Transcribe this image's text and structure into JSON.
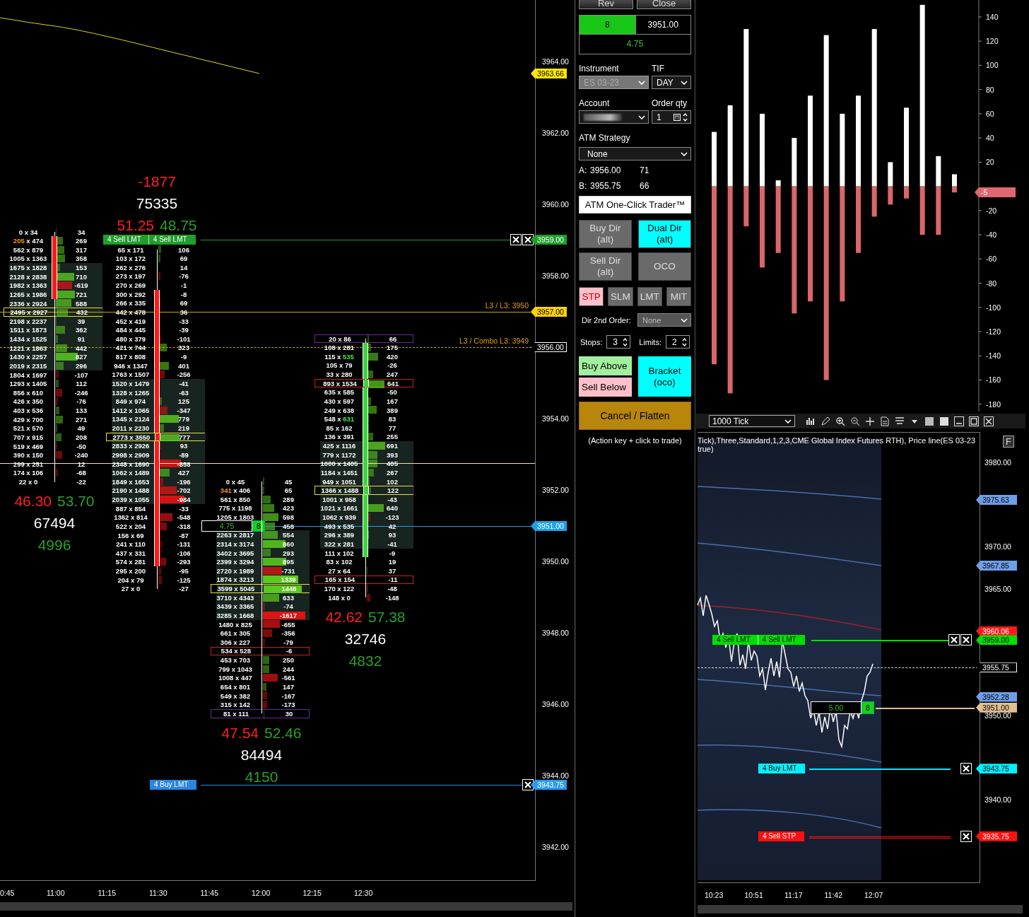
{
  "footprint_chart": {
    "columns": [
      {
        "kind": "bearish",
        "summary_below": {
          "sell_pct": "46.30",
          "buy_pct": "53.70",
          "volume": "67494",
          "delta": "4996"
        },
        "rows": [
          {
            "volume": "0 x 34",
            "delta": "34"
          },
          {
            "volume": "205 x 474",
            "delta": "269",
            "bid_highlighted": true,
            "body": true
          },
          {
            "volume": "562 x 879",
            "delta": "317",
            "body": true
          },
          {
            "volume": "1005 x 1363",
            "delta": "358",
            "body": true
          },
          {
            "volume": "1675 x 1828",
            "delta": "153",
            "value_area": true,
            "body": true
          },
          {
            "volume": "2128 x 2838",
            "delta": "710",
            "value_area": true,
            "body": true
          },
          {
            "volume": "1982 x 1363",
            "delta": "-619",
            "value_area": true,
            "body": true
          },
          {
            "volume": "1265 x 1986",
            "delta": "721",
            "value_area": true,
            "body": true
          },
          {
            "volume": "2336 x 2924",
            "delta": "588",
            "value_area": true
          },
          {
            "volume": "2495 x 2927",
            "delta": "432",
            "value_area": true,
            "color": "#e8e040"
          },
          {
            "volume": "2198 x 2237",
            "delta": "39",
            "value_area": true
          },
          {
            "volume": "1511 x 1873",
            "delta": "362",
            "value_area": true
          },
          {
            "volume": "1434 x 1525",
            "delta": "91",
            "value_area": true
          },
          {
            "volume": "1221 x 1863",
            "delta": "442",
            "value_area": true
          },
          {
            "volume": "1430 x 2257",
            "delta": "827",
            "value_area": true
          },
          {
            "volume": "2019 x 2315",
            "delta": "296",
            "value_area": true
          },
          {
            "volume": "1804 x 1697",
            "delta": "-107"
          },
          {
            "volume": "1293 x 1405",
            "delta": "112"
          },
          {
            "volume": "856 x 610",
            "delta": "-246"
          },
          {
            "volume": "426 x 350",
            "delta": "-76"
          },
          {
            "volume": "403 x 536",
            "delta": "133"
          },
          {
            "volume": "429 x 700",
            "delta": "271"
          },
          {
            "volume": "521 x 570",
            "delta": "49"
          },
          {
            "volume": "707 x 915",
            "delta": "208"
          },
          {
            "volume": "519 x 469",
            "delta": "-50"
          },
          {
            "volume": "390 x 150",
            "delta": "-240"
          },
          {
            "volume": "299 x 251",
            "delta": "12"
          },
          {
            "volume": "174 x 106",
            "delta": "-68"
          },
          {
            "volume": "22 x 0",
            "delta": "-22"
          }
        ]
      },
      {
        "kind": "bearish",
        "summary_above": {
          "sell_pct": "51.25",
          "buy_pct": "48.75",
          "volume": "75335",
          "delta": "-1877"
        },
        "rows": [
          {
            "volume": "65 x 171",
            "delta": "106"
          },
          {
            "volume": "103 x 172",
            "delta": "69"
          },
          {
            "volume": "262 x 276",
            "delta": "14"
          },
          {
            "volume": "273 x 197",
            "delta": "-76"
          },
          {
            "volume": "270 x 269",
            "delta": "-1"
          },
          {
            "volume": "300 x 292",
            "delta": "-8",
            "body": true
          },
          {
            "volume": "266 x 335",
            "delta": "69",
            "body": true
          },
          {
            "volume": "442 x 478",
            "delta": "36",
            "body": true
          },
          {
            "volume": "452 x 419",
            "delta": "-33",
            "body": true
          },
          {
            "volume": "484 x 445",
            "delta": "-39",
            "body": true
          },
          {
            "volume": "480 x 379",
            "delta": "-101",
            "body": true
          },
          {
            "volume": "421 x 744",
            "delta": "323",
            "body": true
          },
          {
            "volume": "817 x 808",
            "delta": "-9",
            "body": true
          },
          {
            "volume": "946 x 1347",
            "delta": "401",
            "body": true
          },
          {
            "volume": "1763 x 1507",
            "delta": "-256",
            "body": true
          },
          {
            "volume": "1520 x 1479",
            "delta": "-41",
            "value_area": true,
            "body": true
          },
          {
            "volume": "1328 x 1265",
            "delta": "-63",
            "value_area": true,
            "body": true
          },
          {
            "volume": "849 x 974",
            "delta": "125",
            "value_area": true,
            "body": true
          },
          {
            "volume": "1412 x 1065",
            "delta": "-347",
            "value_area": true,
            "body": true
          },
          {
            "volume": "1345 x 2124",
            "delta": "779",
            "value_area": true,
            "body": true
          },
          {
            "volume": "2011 x 2230",
            "delta": "219",
            "value_area": true,
            "body": true
          },
          {
            "volume": "2773 x 3550",
            "delta": "777",
            "value_area": true,
            "body": true,
            "color": "#e8e040"
          },
          {
            "volume": "2833 x 2926",
            "delta": "93",
            "value_area": true,
            "body": true
          },
          {
            "volume": "2998 x 2909",
            "delta": "-89",
            "value_area": true,
            "body": true
          },
          {
            "volume": "2348 x 1690",
            "delta": "-858",
            "value_area": true,
            "body": true
          },
          {
            "volume": "1062 x 1489",
            "delta": "427",
            "value_area": true,
            "body": true
          },
          {
            "volume": "1849 x 1653",
            "delta": "-196",
            "value_area": true,
            "body": true
          },
          {
            "volume": "2190 x 1488",
            "delta": "-702",
            "value_area": true,
            "body": true
          },
          {
            "volume": "2039 x 1055",
            "delta": "-984",
            "value_area": true,
            "body": true
          },
          {
            "volume": "887 x 854",
            "delta": "-33",
            "body": true
          },
          {
            "volume": "1362 x 814",
            "delta": "-548",
            "body": true
          },
          {
            "volume": "522 x 204",
            "delta": "-318",
            "body": true
          },
          {
            "volume": "156 x 69",
            "delta": "-87",
            "body": true
          },
          {
            "volume": "241 x 110",
            "delta": "-131",
            "body": true
          },
          {
            "volume": "437 x 331",
            "delta": "-106",
            "body": true
          },
          {
            "volume": "574 x 281",
            "delta": "-293",
            "body": true
          },
          {
            "volume": "295 x 200",
            "delta": "-95"
          },
          {
            "volume": "204 x 79",
            "delta": "-125"
          },
          {
            "volume": "27 x 0",
            "delta": "-27"
          }
        ]
      },
      {
        "kind": "doji",
        "summary_below": {
          "sell_pct": "47.54",
          "buy_pct": "52.46",
          "volume": "84494",
          "delta": "4150"
        },
        "rows": [
          {
            "volume": "0 x 45",
            "delta": "45"
          },
          {
            "volume": "341 x 406",
            "delta": "65",
            "bid_highlighted": true
          },
          {
            "volume": "561 x 850",
            "delta": "289"
          },
          {
            "volume": "775 x 1198",
            "delta": "423"
          },
          {
            "volume": "1205 x 1803",
            "delta": "598"
          },
          {
            "delta": "458"
          },
          {
            "volume": "2263 x 2817",
            "delta": "554",
            "value_area": true
          },
          {
            "volume": "2314 x 3174",
            "delta": "860",
            "value_area": true
          },
          {
            "volume": "3402 x 3695",
            "delta": "293",
            "value_area": true
          },
          {
            "volume": "2399 x 3294",
            "delta": "895",
            "value_area": true
          },
          {
            "volume": "2720 x 1989",
            "delta": "-731",
            "value_area": true
          },
          {
            "volume": "1874 x 3213",
            "delta": "1339",
            "value_area": true
          },
          {
            "volume": "3599 x 5045",
            "delta": "1446",
            "value_area": true,
            "color": "#e8e040"
          },
          {
            "volume": "3710 x 4343",
            "delta": "633",
            "value_area": true
          },
          {
            "volume": "3439 x 3365",
            "delta": "-74",
            "value_area": true
          },
          {
            "volume": "3285 x 1668",
            "delta": "-1617",
            "value_area": true
          },
          {
            "volume": "1480 x 825",
            "delta": "-655"
          },
          {
            "volume": "661 x 305",
            "delta": "-356"
          },
          {
            "volume": "306 x 227",
            "delta": "-79"
          },
          {
            "volume": "534 x 528",
            "delta": "-6",
            "color": "#d02020"
          },
          {
            "volume": "453 x 703",
            "delta": "250"
          },
          {
            "volume": "799 x 1043",
            "delta": "244"
          },
          {
            "volume": "1008 x 447",
            "delta": "-561"
          },
          {
            "volume": "654 x 801",
            "delta": "147"
          },
          {
            "volume": "549 x 382",
            "delta": "-167"
          },
          {
            "volume": "315 x 142",
            "delta": "-173"
          },
          {
            "volume": "81 x 111",
            "delta": "30",
            "color": "#6a2a9a"
          }
        ]
      },
      {
        "kind": "bullish",
        "summary_below": {
          "sell_pct": "42.62",
          "buy_pct": "57.38",
          "volume": "32746",
          "delta": "4832"
        },
        "rows": [
          {
            "volume": "20 x 86",
            "delta": "66",
            "color": "#6a2a9a"
          },
          {
            "volume": "108 x 281",
            "delta": "175",
            "body": true
          },
          {
            "volume": "115 x 535",
            "delta": "420",
            "ask_highlighted": true,
            "body": true
          },
          {
            "volume": "105 x 79",
            "delta": "-26",
            "body": true
          },
          {
            "volume": "33 x 280",
            "delta": "247",
            "body": true
          },
          {
            "volume": "893 x 1534",
            "delta": "641",
            "color": "#d02020",
            "body": true
          },
          {
            "volume": "635 x 585",
            "delta": "-50",
            "body": true
          },
          {
            "volume": "430 x 597",
            "delta": "167",
            "body": true
          },
          {
            "volume": "249 x 638",
            "delta": "389",
            "body": true
          },
          {
            "volume": "548 x 631",
            "delta": "83",
            "ask_highlighted": true,
            "body": true
          },
          {
            "volume": "85 x 162",
            "delta": "77",
            "body": true
          },
          {
            "volume": "136 x 391",
            "delta": "255",
            "body": true
          },
          {
            "volume": "425 x 1116",
            "delta": "691",
            "value_area": true,
            "body": true
          },
          {
            "volume": "779 x 1172",
            "delta": "393",
            "value_area": true,
            "body": true
          },
          {
            "volume": "1000 x 1405",
            "delta": "405",
            "value_area": true,
            "body": true
          },
          {
            "volume": "1184 x 1451",
            "delta": "267",
            "value_area": true,
            "body": true
          },
          {
            "volume": "949 x 1051",
            "delta": "102",
            "value_area": true,
            "body": true
          },
          {
            "volume": "1366 x 1488",
            "delta": "122",
            "value_area": true,
            "color": "#e8e040",
            "body": true
          },
          {
            "volume": "1001 x 958",
            "delta": "-43",
            "value_area": true,
            "body": true
          },
          {
            "volume": "1021 x 1661",
            "delta": "640",
            "value_area": true,
            "body": true
          },
          {
            "volume": "1062 x 939",
            "delta": "-123",
            "value_area": true,
            "body": true
          },
          {
            "volume": "493 x 535",
            "delta": "42",
            "value_area": true,
            "body": true
          },
          {
            "volume": "296 x 389",
            "delta": "93",
            "value_area": true,
            "body": true
          },
          {
            "volume": "322 x 281",
            "delta": "-41",
            "value_area": true,
            "body": true
          },
          {
            "volume": "111 x 102",
            "delta": "-9",
            "body": true
          },
          {
            "volume": "83 x 102",
            "delta": "19"
          },
          {
            "volume": "27 x 64",
            "delta": "37"
          },
          {
            "volume": "165 x 154",
            "delta": "-11",
            "color": "#d02020"
          },
          {
            "volume": "170 x 122",
            "delta": "-48"
          },
          {
            "volume": "148 x 0",
            "delta": "-148"
          }
        ]
      }
    ],
    "price_lines": [
      {
        "kind": "indicator",
        "tag": "3963.66"
      },
      {
        "kind": "sell_limit",
        "tag": "3959.00",
        "labels": [
          "4  Sell LMT",
          "4  Sell LMT"
        ]
      },
      {
        "kind": "level",
        "tag": "3957.00",
        "label": "L3 / L3: 3950"
      },
      {
        "kind": "combo_level",
        "tag": "3956.00",
        "label": "L3 / Combo L3: 3949"
      },
      {
        "kind": "marker"
      },
      {
        "kind": "position",
        "tag": "3951.00",
        "pnl": "4.75",
        "qty": "8"
      },
      {
        "kind": "buy_limit",
        "tag": "3943.75",
        "labels": [
          "4  Buy LMT"
        ]
      }
    ],
    "axis_labels": [
      "3964.00",
      "3962.00",
      "3960.00",
      "3958.00",
      "3954.00",
      "3952.00",
      "3950.00",
      "3948.00",
      "3946.00",
      "3944.00",
      "3942.00"
    ],
    "time_labels": [
      "0:45",
      "11:00",
      "11:15",
      "11:30",
      "11:45",
      "12:00",
      "12:15",
      "12:30"
    ]
  },
  "order_panel": {
    "top_buttons": [
      "Rev",
      "Close"
    ],
    "position": {
      "qty": "8",
      "price": "3951.00",
      "pnl": "4.75"
    },
    "instrument": {
      "label": "Instrument",
      "value": "ES 03-23",
      "disabled": true
    },
    "tif": {
      "label": "TIF",
      "value": "DAY"
    },
    "account": {
      "label": "Account"
    },
    "order_qty": {
      "label": "Order qty",
      "value": "1"
    },
    "atm_strategy": {
      "label": "ATM Strategy",
      "value": "None"
    },
    "quotes": [
      {
        "side": "A:",
        "price": "3956.00",
        "size": "71"
      },
      {
        "side": "B:",
        "price": "3955.75",
        "size": "66"
      }
    ],
    "atm_button": "ATM One-Click Trader™",
    "mode_buttons": [
      {
        "label": "Buy Dir (alt)",
        "selected": false
      },
      {
        "label": "Dual Dir (alt)",
        "selected": true
      },
      {
        "label": "Sell Dir (alt)",
        "selected": false
      },
      {
        "label": "OCO",
        "selected": false
      }
    ],
    "order_types": [
      {
        "label": "STP",
        "selected": true
      },
      {
        "label": "SLM",
        "selected": false
      },
      {
        "label": "LMT",
        "selected": false
      },
      {
        "label": "MIT",
        "selected": false
      }
    ],
    "dir_2nd_order": {
      "label": "Dir 2nd Order:",
      "value": "None"
    },
    "stops": {
      "label": "Stops:",
      "value": "3"
    },
    "limits": {
      "label": "Limits:",
      "value": "2"
    },
    "buy_above": "Buy Above",
    "sell_below": "Sell Below",
    "bracket": {
      "label": "Bracket (oco)",
      "selected": true
    },
    "cancel_flatten": "Cancel / Flatten",
    "hint": "(Action key + click to trade)"
  },
  "histogram": {
    "value_tag": "-5",
    "chart_data": {
      "type": "bar",
      "categories": [
        null,
        null,
        null,
        null,
        null,
        null,
        null,
        null,
        null,
        null,
        null,
        null,
        null,
        null,
        null,
        null
      ],
      "stacked": true,
      "ylim": [
        -186,
        154
      ],
      "yticks": [
        140,
        120,
        100,
        80,
        60,
        40,
        20,
        -20,
        -40,
        -60,
        -80,
        -100,
        -120,
        -140,
        -160,
        -180
      ],
      "series": [
        {
          "color": "#ffffff",
          "values": [
            45,
            67,
            130,
            60,
            5,
            40,
            75,
            125,
            60,
            75,
            130,
            20,
            65,
            150,
            25,
            10
          ]
        },
        {
          "color": "#d9666b",
          "values": [
            -147,
            -171,
            -33,
            -67,
            -55,
            -105,
            -95,
            -160,
            -95,
            -55,
            -25,
            -15,
            -10,
            -40,
            -40,
            -5
          ]
        }
      ]
    }
  },
  "tick_chart": {
    "interval": "1000 Tick",
    "title_lines": [
      "Tick),Three,Standard,1,2,3,CME Global Index Futures RTH), Price line(ES 03-23",
      "true)"
    ],
    "f_button": "F",
    "axis_labels": [
      "3980.00",
      "3970.00",
      "3965.00",
      "3950.00",
      "3940.00"
    ],
    "price_tags": [
      {
        "kind": "band",
        "tag": "3975.63"
      },
      {
        "kind": "band",
        "tag": "3967.85"
      },
      {
        "kind": "mid",
        "tag": "3960.06"
      },
      {
        "kind": "last",
        "tag": "3955.75"
      },
      {
        "kind": "band",
        "tag": "3952.28"
      }
    ],
    "order_lines": [
      {
        "kind": "sell_limit",
        "tag": "3959.00",
        "labels": [
          "4  Sell LMT",
          "4  Sell LMT"
        ]
      },
      {
        "kind": "position",
        "tag": "3951.00",
        "pnl": "5.00",
        "qty": "8"
      },
      {
        "kind": "buy_limit",
        "tag": "3943.75",
        "labels": [
          "4  Buy LMT"
        ]
      },
      {
        "kind": "sell_stop",
        "tag": "3935.75",
        "labels": [
          "4  Sell STP"
        ]
      }
    ],
    "time_labels": [
      "10:23",
      "10:51",
      "11:17",
      "11:42",
      "12:07"
    ]
  }
}
